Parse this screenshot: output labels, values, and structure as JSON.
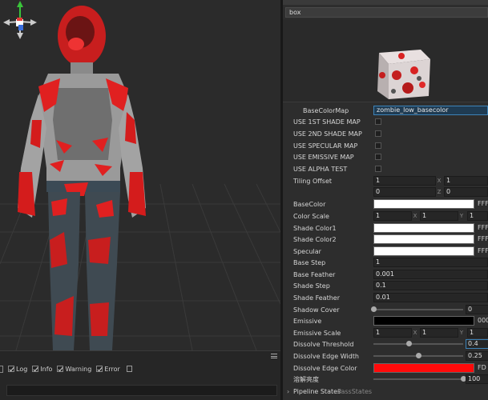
{
  "material": {
    "name": "box"
  },
  "console": {
    "filters": [
      {
        "label": "Log"
      },
      {
        "label": "Info"
      },
      {
        "label": "Warning"
      },
      {
        "label": "Error"
      }
    ]
  },
  "props": {
    "base_color_map": {
      "label": "BaseColorMap",
      "value": "zombie_low_basecolor"
    },
    "use_1st_shade": {
      "label": "USE 1ST SHADE MAP"
    },
    "use_2nd_shade": {
      "label": "USE 2ND SHADE MAP"
    },
    "use_specular": {
      "label": "USE SPECULAR MAP"
    },
    "use_emissive": {
      "label": "USE EMISSIVE MAP"
    },
    "use_alpha": {
      "label": "USE ALPHA TEST"
    },
    "tiling_offset": {
      "label": "Tiling Offset",
      "r1": [
        "1",
        "1"
      ],
      "r2": [
        "0",
        "0"
      ],
      "axes1": [
        "X",
        ""
      ],
      "axes2": [
        "",
        "Z"
      ]
    },
    "base_color": {
      "label": "BaseColor",
      "hex": "FFF",
      "color": "#ffffff"
    },
    "color_scale": {
      "label": "Color Scale",
      "values": [
        "1",
        "1",
        "1"
      ],
      "axes": [
        "X",
        "Y"
      ]
    },
    "shade_color1": {
      "label": "Shade Color1",
      "hex": "FFF",
      "color": "#ffffff"
    },
    "shade_color2": {
      "label": "Shade Color2",
      "hex": "FFF",
      "color": "#ffffff"
    },
    "specular": {
      "label": "Specular",
      "hex": "FFF",
      "color": "#ffffff"
    },
    "base_step": {
      "label": "Base Step",
      "value": "1"
    },
    "base_feather": {
      "label": "Base Feather",
      "value": "0.001"
    },
    "shade_step": {
      "label": "Shade Step",
      "value": "0.1"
    },
    "shade_feather": {
      "label": "Shade Feather",
      "value": "0.01"
    },
    "shadow_cover": {
      "label": "Shadow Cover",
      "value": "0",
      "level": 0
    },
    "emissive": {
      "label": "Emissive",
      "hex": "000",
      "color": "#000000"
    },
    "emissive_scale": {
      "label": "Emissive Scale",
      "values": [
        "1",
        "1",
        "1"
      ],
      "axes": [
        "X",
        "Y"
      ]
    },
    "dissolve_threshold": {
      "label": "Dissolve Threshold",
      "value": "0.4",
      "level": 0.4
    },
    "dissolve_edge_width": {
      "label": "Dissolve Edge Width",
      "value": "0.25",
      "level": 0.5
    },
    "dissolve_edge_color": {
      "label": "Dissolve Edge Color",
      "hex": "FD",
      "color": "#ff0a0a"
    },
    "dissolve_brightness": {
      "label": "溶解亮度",
      "value": "100",
      "level": 1
    },
    "pipeline_states": {
      "label": "Pipeline States",
      "value": "PassStates"
    }
  },
  "colors": {
    "accent": "#3d83b8",
    "gizmo_x": "#e03a3a",
    "gizmo_y": "#3ac43a",
    "gizmo_z": "#3a6fe0"
  }
}
